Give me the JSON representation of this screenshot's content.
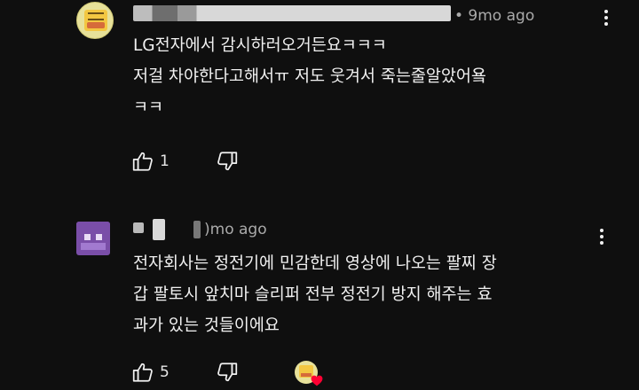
{
  "comments": [
    {
      "timestamp": "• 9mo ago",
      "lines": [
        "LG전자에서 감시하러오거든요ㅋㅋㅋ",
        "저걸 차야한다고해서ㅠ 저도 웃겨서 죽는줄알았어욬",
        "ㅋㅋ"
      ],
      "like_count": "1"
    },
    {
      "timestamp": ")mo ago",
      "lines": [
        "전자회사는 정전기에 민감한데 영상에 나오는 팔찌 장",
        "갑 팔토시 앞치마 슬리퍼 전부 정전기 방지 해주는 효",
        "과가 있는 것들이에요"
      ],
      "like_count": "5"
    }
  ],
  "icons": {
    "like": "thumbs-up-icon",
    "dislike": "thumbs-down-icon",
    "more": "more-vertical-icon",
    "heart": "heart-icon"
  },
  "colors": {
    "background": "#0f0f0f",
    "text": "#f1f1f1",
    "meta": "#aaaaaa",
    "heart": "#ff0033"
  }
}
